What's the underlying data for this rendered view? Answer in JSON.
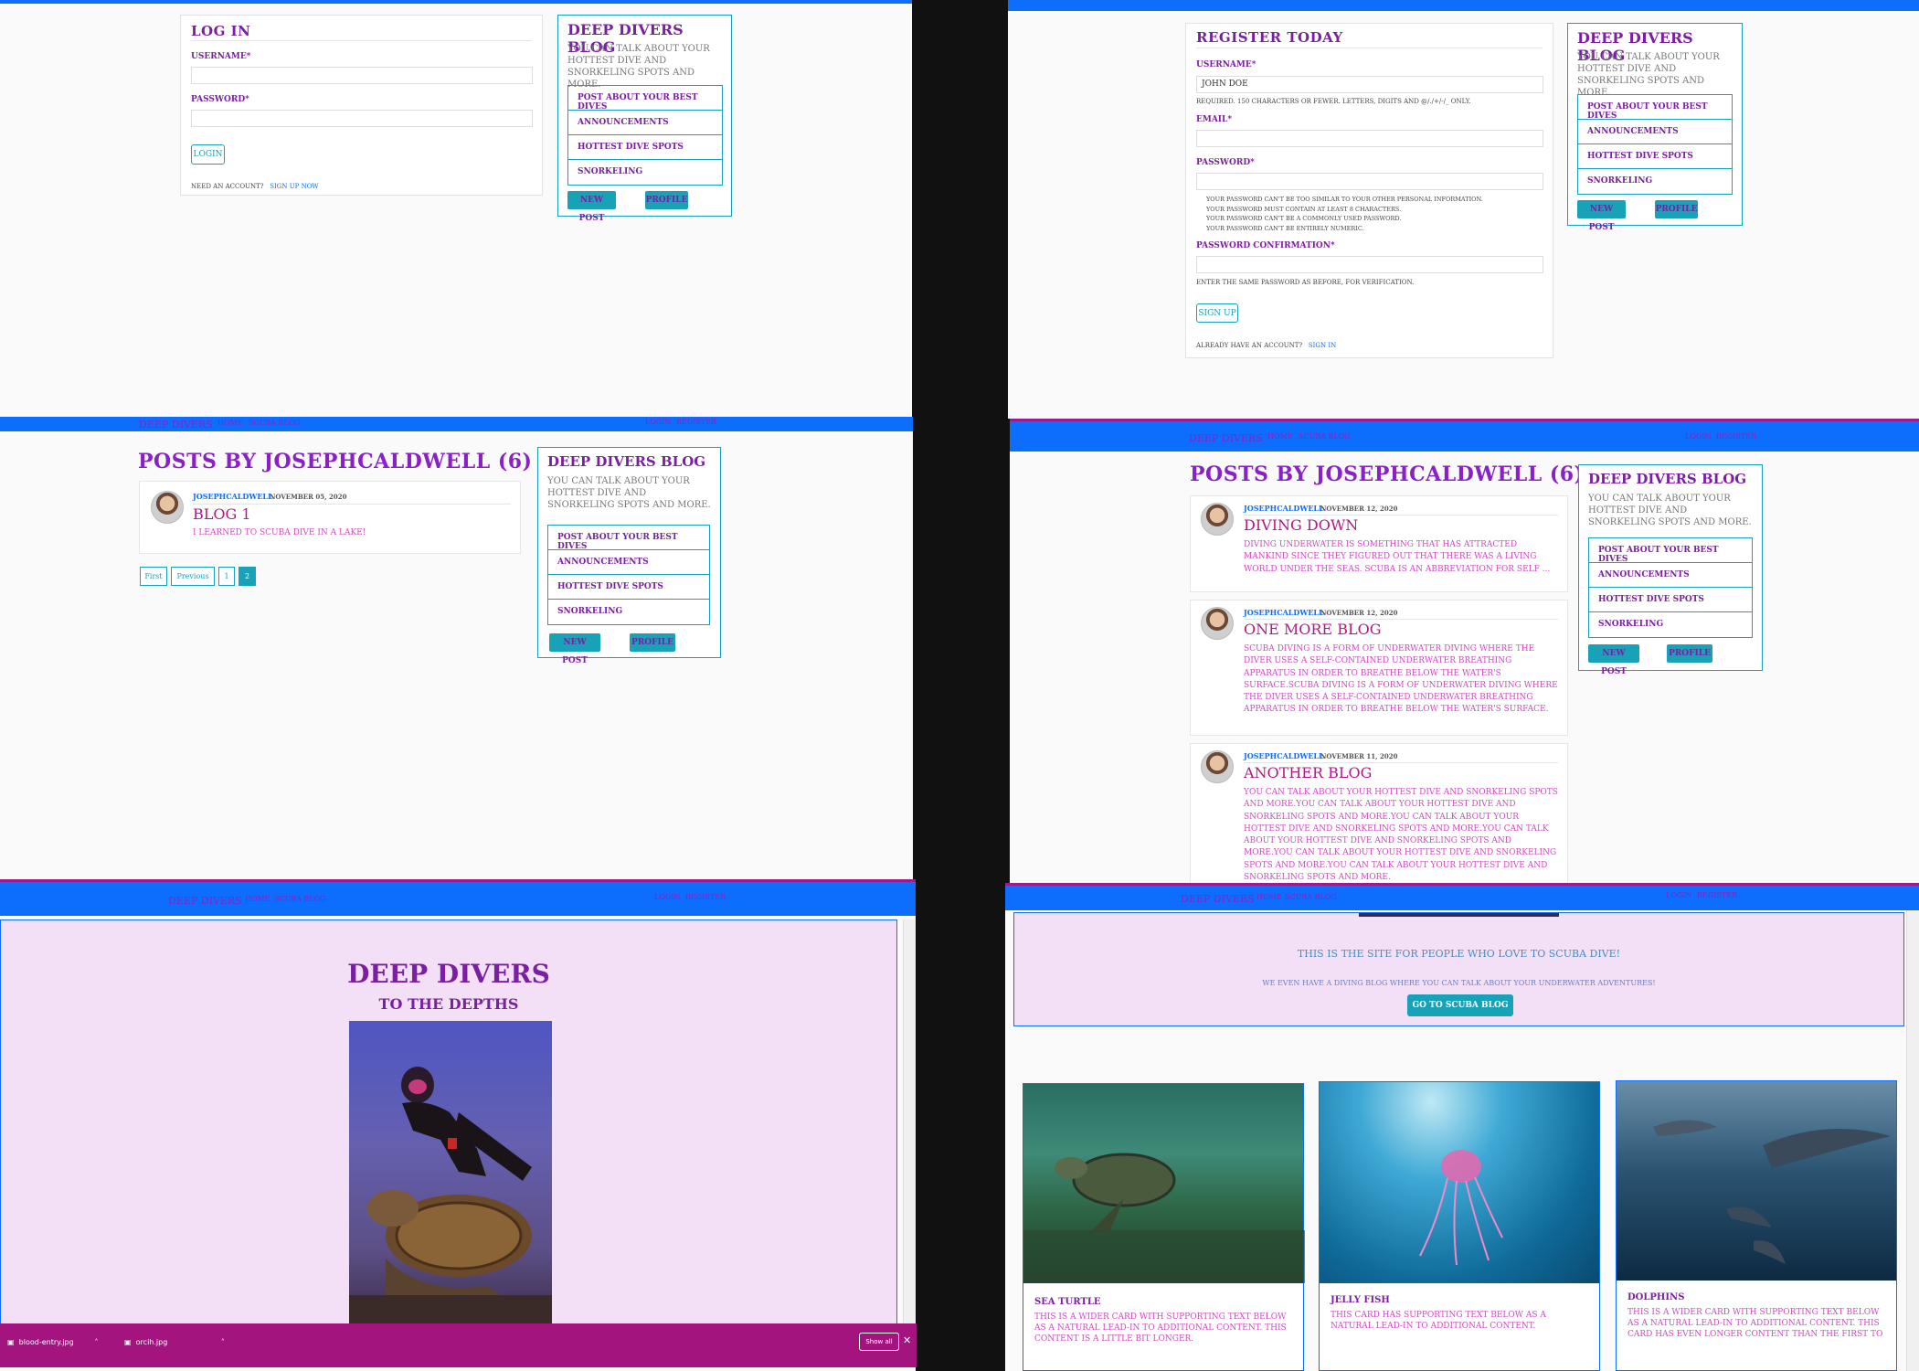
{
  "brand": "Deep Divers",
  "nav": {
    "home": "Home",
    "scuba_blog": "Scuba Blog",
    "login": "Login",
    "register": "Register"
  },
  "sidebar": {
    "title": "Deep Divers Blog",
    "desc": "You can talk about your hottest dive and snorkeling spots and more.",
    "items": [
      "Post about your best dives",
      "Announcements",
      "Hottest dive spots",
      "Snorkeling"
    ],
    "new_post": "New Post",
    "profile": "Profile"
  },
  "login": {
    "title": "Log In",
    "username_label": "Username*",
    "password_label": "Password*",
    "button": "Login",
    "need_account": "Need an account?",
    "sign_up": "Sign Up Now"
  },
  "register": {
    "title": "Register Today",
    "username_label": "Username*",
    "username_value": "john doe",
    "username_help": "Required. 150 characters or fewer. Letters, digits and @/./+/-/_ only.",
    "email_label": "Email*",
    "password_label": "Password*",
    "password_rules": [
      "Your password can't be too similar to your other personal information.",
      "Your password must contain at least 8 characters.",
      "Your password can't be a commonly used password.",
      "Your password can't be entirely numeric."
    ],
    "confirm_label": "Password confirmation*",
    "confirm_help": "Enter the same password as before, for verification.",
    "button": "Sign Up",
    "have_account": "Already have an account?",
    "sign_in": "Sign In"
  },
  "user_posts": {
    "heading": "Posts by josephcaldwell (6)",
    "single": {
      "author": "josephcaldwell",
      "date": "November 05, 2020",
      "title": "Blog 1",
      "text": "I learned to scuba dive in a lake!"
    },
    "pagination": [
      "First",
      "Previous",
      "1",
      "2"
    ],
    "list": [
      {
        "author": "josephcaldwell",
        "date": "November 12, 2020",
        "title": "Diving Down",
        "text": "Diving underwater is something that has attracted mankind since they figured out that there was a living world under the seas. Scuba is an abbreviation for self ..."
      },
      {
        "author": "josephcaldwell",
        "date": "November 12, 2020",
        "title": "One more blog",
        "text": "Scuba diving is a form of underwater diving where the diver uses a self-contained underwater breathing apparatus in order to breathe below the water's surface.Scuba diving is a form of underwater diving where the diver uses a self-contained underwater breathing apparatus in order to breathe below the water's surface."
      },
      {
        "author": "josephcaldwell",
        "date": "November 11, 2020",
        "title": "Another Blog",
        "text": "You can talk about your hottest dive and snorkeling spots and more.You can talk about your hottest dive and snorkeling spots and more.You can talk about your hottest dive and snorkeling spots and more.You can talk about your hottest dive and snorkeling spots and more.You can talk about your hottest dive and snorkeling spots and more.You can talk about your hottest dive and snorkeling spots and more."
      }
    ]
  },
  "home": {
    "title": "Deep Divers",
    "subtitle": "To The Depths",
    "lead": "This is the site for people who love to scuba dive!",
    "sub": "We even have a diving blog where you can talk about your underwater adventures!",
    "cta": "Go to Scuba Blog",
    "cards": [
      {
        "title": "Sea Turtle",
        "text": "This is a wider card with supporting text below as a natural lead-in to additional content. This content is a little bit longer."
      },
      {
        "title": "Jelly Fish",
        "text": "This card has supporting text below as a natural lead-in to additional content."
      },
      {
        "title": "Dolphins",
        "text": "This is a wider card with supporting text below as a natural lead-in to additional content. This card has even longer content than the first to"
      }
    ]
  },
  "downloads": {
    "file1": "blood-entry.jpg",
    "file2": "orcih.jpg",
    "show_all": "Show all"
  },
  "colors": {
    "navbar": "#0d6efd",
    "accent": "#17a2b8",
    "purple": "#7b1fa2",
    "magenta": "#b01889",
    "jumbotron": "#f3e0f7"
  }
}
